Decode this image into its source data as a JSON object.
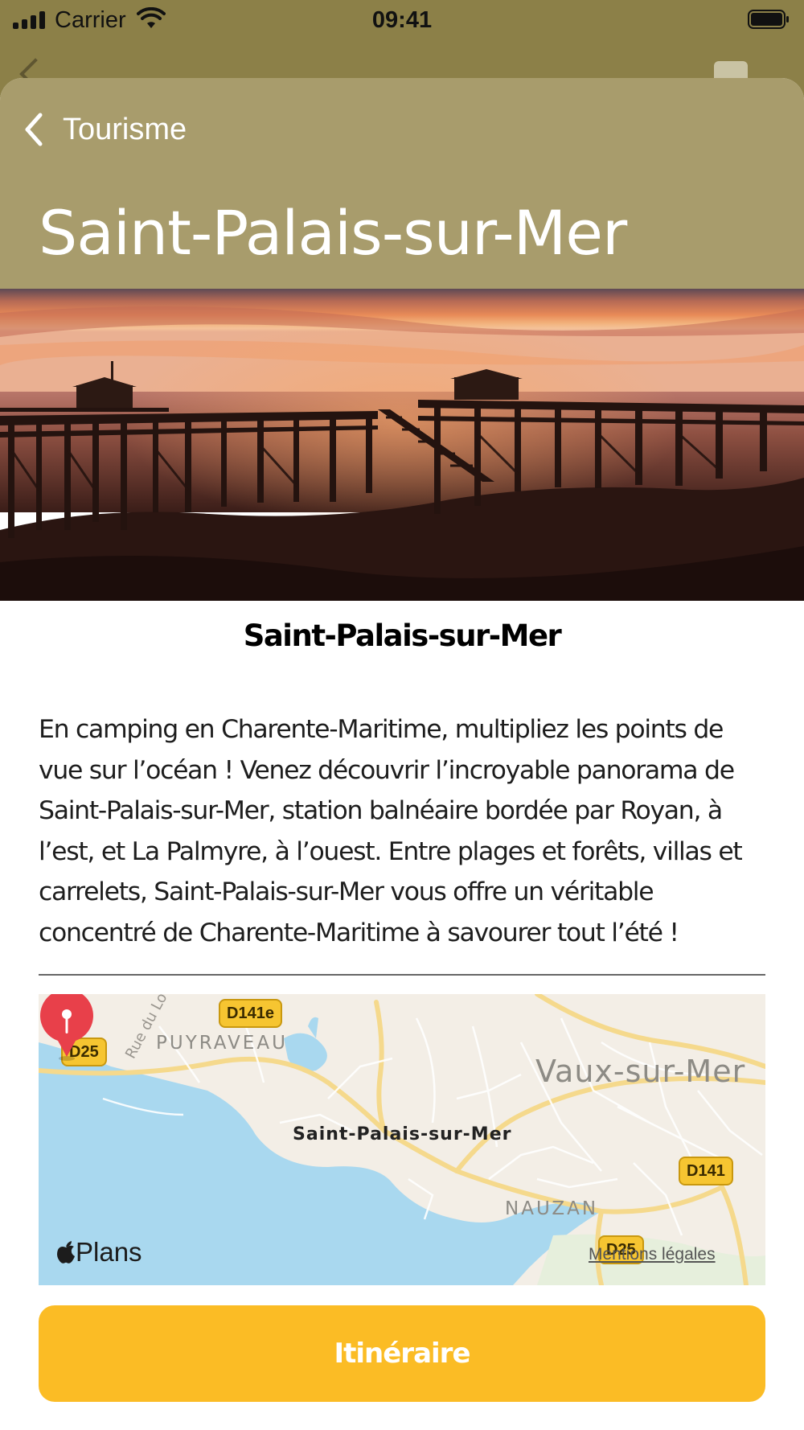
{
  "status_bar": {
    "carrier": "Carrier",
    "time": "09:41"
  },
  "header": {
    "back_label": "Tourisme",
    "title": "Saint-Palais-sur-Mer"
  },
  "hero_image": {
    "alt": "Carrelets au coucher du soleil"
  },
  "content": {
    "title": "Saint-Palais-sur-Mer",
    "description": "En camping en Charente-Maritime, multipliez les points de vue sur l’océan ! Venez découvrir l’incroyable panorama de Saint-Palais-sur-Mer, station balnéaire bordée par Royan, à l’est, et La Palmyre, à l’ouest. Entre plages et forêts, villas et carrelets, Saint-Palais-sur-Mer vous offre un véritable concentré de Charente-Maritime à savourer tout l’été !"
  },
  "map": {
    "roads": [
      "D141e",
      "D25",
      "D141",
      "D25"
    ],
    "places": {
      "puyraveau": "PUYRAVEAU",
      "vaux": "Vaux-sur-Mer",
      "nauzan": "NAUZAN",
      "main": "Saint-Palais-sur-Mer"
    },
    "street": "Rue du Lo",
    "brand": "Plans",
    "legal": "Mentions légales"
  },
  "actions": {
    "itinerary_label": "Itinéraire"
  },
  "colors": {
    "header": "#a89c6c",
    "underlay": "#8c8048",
    "button": "#fbbc25",
    "pin": "#e8404a",
    "water": "#a9d8ef"
  }
}
